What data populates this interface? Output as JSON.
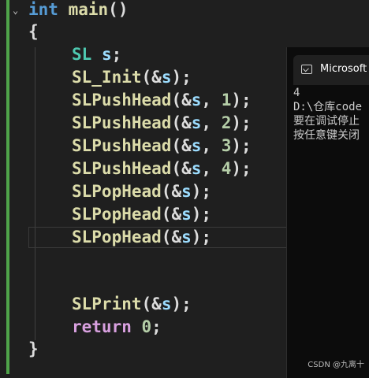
{
  "editor": {
    "fold_glyph": "⌄",
    "line1": {
      "kw": "int",
      "fn": "main",
      "rest": "()"
    },
    "line2": {
      "text": "{"
    },
    "line3": {
      "type": "SL",
      "var": "s",
      "rest": ";"
    },
    "line4": {
      "fn": "SL_Init",
      "open": "(&",
      "var": "s",
      "close": ");"
    },
    "line5": {
      "fn": "SLPushHead",
      "open": "(&",
      "var": "s",
      "sep": ", ",
      "num": "1",
      "close": ");"
    },
    "line6": {
      "fn": "SLPushHead",
      "open": "(&",
      "var": "s",
      "sep": ", ",
      "num": "2",
      "close": ");"
    },
    "line7": {
      "fn": "SLPushHead",
      "open": "(&",
      "var": "s",
      "sep": ", ",
      "num": "3",
      "close": ");"
    },
    "line8": {
      "fn": "SLPushHead",
      "open": "(&",
      "var": "s",
      "sep": ", ",
      "num": "4",
      "close": ");"
    },
    "line9": {
      "fn": "SLPopHead",
      "open": "(&",
      "var": "s",
      "close": ");"
    },
    "line10": {
      "fn": "SLPopHead",
      "open": "(&",
      "var": "s",
      "close": ");"
    },
    "line11": {
      "fn": "SLPopHead",
      "open": "(&",
      "var": "s",
      "close": ");"
    },
    "line14": {
      "fn": "SLPrint",
      "open": "(&",
      "var": "s",
      "close": ");"
    },
    "line15": {
      "kw": "return",
      "num": "0",
      "rest": ";"
    },
    "line16": {
      "text": "}"
    }
  },
  "console": {
    "icon": "terminal-icon",
    "title": "Microsoft V",
    "output": [
      "4",
      "D:\\仓库code",
      "要在调试停止",
      "按任意键关闭"
    ]
  },
  "watermark": "CSDN @九离十",
  "colors": {
    "background": "#1f1f1f",
    "keyword": "#569cd6",
    "control_keyword": "#d8a0df",
    "function": "#dcdcaa",
    "type": "#4ec9b0",
    "variable": "#9cdcfe",
    "number": "#b5cea8",
    "change_bar": "#4fa34a"
  }
}
